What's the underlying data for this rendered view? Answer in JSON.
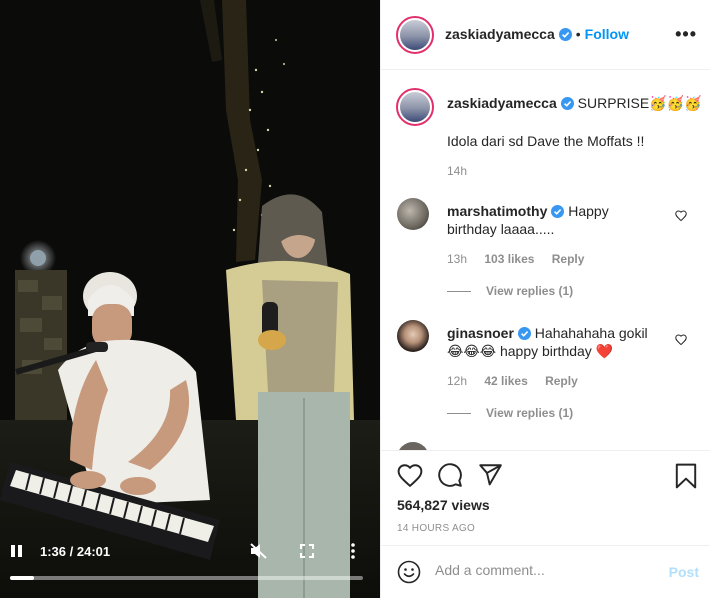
{
  "video": {
    "time": "1:36 / 24:01",
    "progress": 0.067
  },
  "header": {
    "username": "zaskiadyamecca",
    "separator": "•",
    "follow_label": "Follow",
    "more_label": "•••"
  },
  "caption": {
    "username": "zaskiadyamecca",
    "text_line1": "SURPRISE🥳🥳🥳",
    "text_line2": "Idola dari sd Dave the Moffats !!",
    "time": "14h"
  },
  "comments": [
    {
      "username": "marshatimothy",
      "text_inline": "Happy",
      "text_cont": "birthday laaaa.....",
      "time": "13h",
      "likes": "103 likes",
      "reply_label": "Reply",
      "view_replies": "View replies (1)"
    },
    {
      "username": "ginasnoer",
      "text_inline": "Hahahahaha gokil",
      "text_cont": "😂😂😂 happy birthday ❤️",
      "time": "12h",
      "likes": "42 likes",
      "reply_label": "Reply",
      "view_replies": "View replies (1)"
    }
  ],
  "stats": {
    "views": "564,827 views",
    "posted": "14 HOURS AGO"
  },
  "add_comment": {
    "placeholder": "Add a comment...",
    "post_label": "Post"
  },
  "colors": {
    "link": "#0095f6",
    "verified": "#3897f0",
    "muted": "#8e8e8e",
    "post_disabled": "#b2dffc"
  },
  "icons": [
    "pause-icon",
    "mute-icon",
    "fullscreen-icon",
    "kebab-icon",
    "heart-icon",
    "comment-icon",
    "share-icon",
    "bookmark-icon",
    "emoji-icon",
    "verified-icon"
  ]
}
